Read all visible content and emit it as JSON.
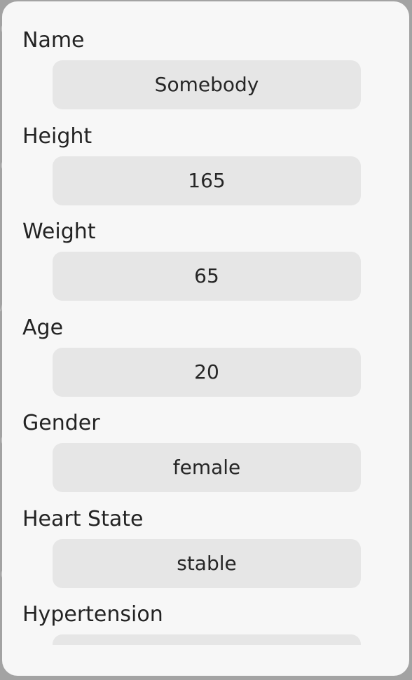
{
  "form": {
    "fields": [
      {
        "label": "Name",
        "value": "Somebody"
      },
      {
        "label": "Height",
        "value": "165"
      },
      {
        "label": "Weight",
        "value": "65"
      },
      {
        "label": "Age",
        "value": "20"
      },
      {
        "label": "Gender",
        "value": "female"
      },
      {
        "label": "Heart State",
        "value": "stable"
      },
      {
        "label": "Hypertension",
        "value": ""
      }
    ]
  }
}
